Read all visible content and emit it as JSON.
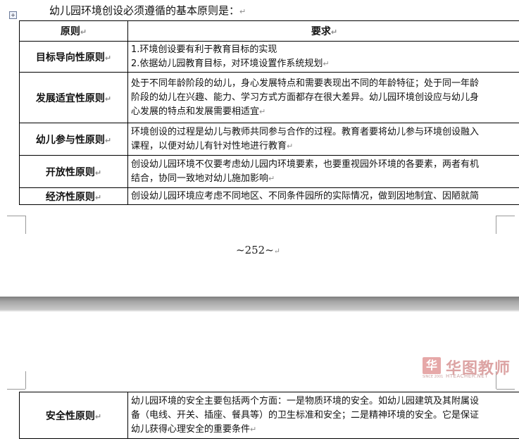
{
  "intro": "幼儿园环境创设必须遵循的基本原则是：",
  "header": {
    "principle": "原则",
    "requirement": "要求"
  },
  "para_mark": "↵",
  "rows": [
    {
      "principle": "目标导向性原则",
      "lines": [
        "1.环境创设要有利于教育目标的实现",
        "2.依据幼儿园教育目标，对环境设置作系统规划"
      ]
    },
    {
      "principle": "发展适宜性原则",
      "lines": [
        "处于不同年龄阶段的幼儿，身心发展特点和需要表现出不同的年龄特征；处于同一年龄",
        "阶段的幼儿在兴趣、能力、学习方式方面都存在很大差异。幼儿园环境创设应与幼儿身",
        "心发展的特点和发展需要相适宜"
      ]
    },
    {
      "principle": "幼儿参与性原则",
      "lines": [
        "环境创设的过程是幼儿与教师共同参与合作的过程。教育者要将幼儿参与环境创设融入",
        "课程，以便对幼儿有针对性地进行教育"
      ]
    },
    {
      "principle": "开放性原则",
      "lines": [
        "创设幼儿园环境不仅要考虑幼儿园内环境要素，也要重视园外环境的各要素，两者有机",
        "结合，协同一致地对幼儿施加影响"
      ]
    },
    {
      "principle": "经济性原则",
      "lines": [
        "创设幼儿园环境应考虑不同地区、不同条件园所的实际情况，做到因地制宜、因陋就简"
      ]
    }
  ],
  "page_number": "~252~",
  "logo": {
    "name": "华图教师",
    "url": "HTEACHER.NET",
    "since": "SINCE 2001",
    "glyph": "华"
  },
  "row2": {
    "principle": "安全性原则",
    "lines": [
      "幼儿园环境的安全主要包括两个方面：一是物质环境的安全。如幼儿园建筑及其附属设",
      "备（电线、开关、插座、餐具等）的卫生标准和安全；二是精神环境的安全。它是保证",
      "幼儿获得心理安全的重要条件"
    ]
  }
}
